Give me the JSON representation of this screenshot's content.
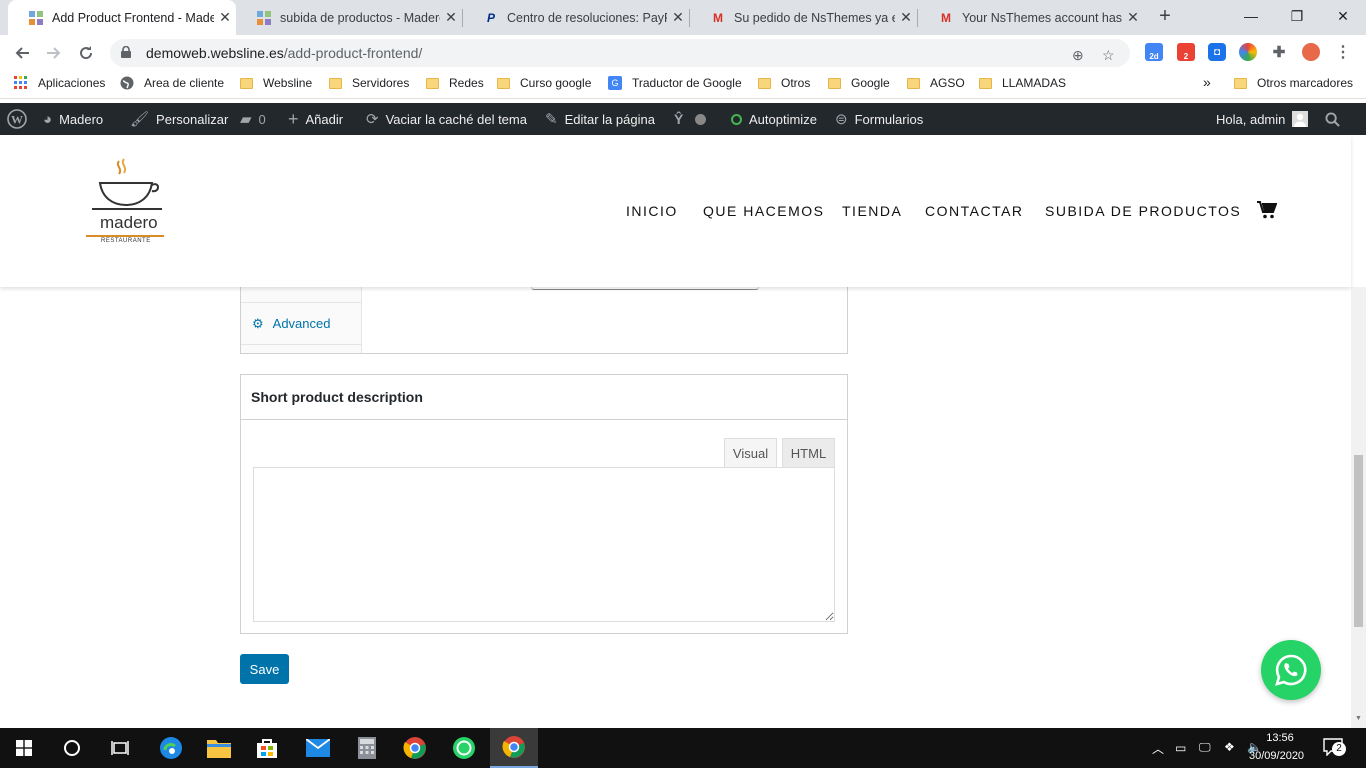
{
  "browser": {
    "tabs": [
      {
        "title": "Add Product Frontend - Made",
        "active": true
      },
      {
        "title": "subida de productos - Madero",
        "active": false
      },
      {
        "title": "Centro de resoluciones: PayPal",
        "active": false
      },
      {
        "title": "Su pedido de NsThemes ya est",
        "active": false
      },
      {
        "title": "Your NsThemes account has be",
        "active": false
      }
    ],
    "new_tab": "+",
    "url_host": "demoweb.websline.es",
    "url_path": "/add-product-frontend/",
    "bookmarks": [
      {
        "label": "Aplicaciones",
        "icon": "apps-grid-icon"
      },
      {
        "label": "Area de cliente",
        "icon": "globe-icon"
      },
      {
        "label": "Websline",
        "icon": "folder-icon"
      },
      {
        "label": "Servidores",
        "icon": "folder-icon"
      },
      {
        "label": "Redes",
        "icon": "folder-icon"
      },
      {
        "label": "Curso google",
        "icon": "folder-icon"
      },
      {
        "label": "Traductor de Google",
        "icon": "google-translate-icon"
      },
      {
        "label": "Otros",
        "icon": "folder-icon"
      },
      {
        "label": "Google",
        "icon": "folder-icon"
      },
      {
        "label": "AGSO",
        "icon": "folder-icon"
      },
      {
        "label": "LLAMADAS",
        "icon": "folder-icon"
      }
    ],
    "bookmarks_overflow": "»",
    "other_bookmarks": "Otros marcadores",
    "extension_badges": {
      "badge_a": "2d",
      "badge_b": "2"
    }
  },
  "adminbar": {
    "site": "Madero",
    "customize": "Personalizar",
    "comments": "0",
    "add": "Añadir",
    "clear_cache": "Vaciar la caché del tema",
    "edit_page": "Editar la página",
    "autoptimize": "Autoptimize",
    "forms": "Formularios",
    "greeting": "Hola, admin"
  },
  "site": {
    "logo_name": "madero",
    "logo_sub": "RESTAURANTE",
    "nav": [
      "INICIO",
      "QUE HACEMOS",
      "TIENDA",
      "CONTACTAR",
      "SUBIDA DE PRODUCTOS"
    ]
  },
  "product_panel": {
    "advanced_tab": "Advanced"
  },
  "short_description": {
    "title": "Short product description",
    "tab_visual": "Visual",
    "tab_html": "HTML",
    "value": ""
  },
  "save_label": "Save",
  "taskbar": {
    "time": "13:56",
    "date": "30/09/2020",
    "notifications": "2"
  },
  "colors": {
    "wp_blue": "#0073aa",
    "whatsapp": "#25d366",
    "adminbar": "#23282d",
    "logo_orange": "#d98c26"
  }
}
